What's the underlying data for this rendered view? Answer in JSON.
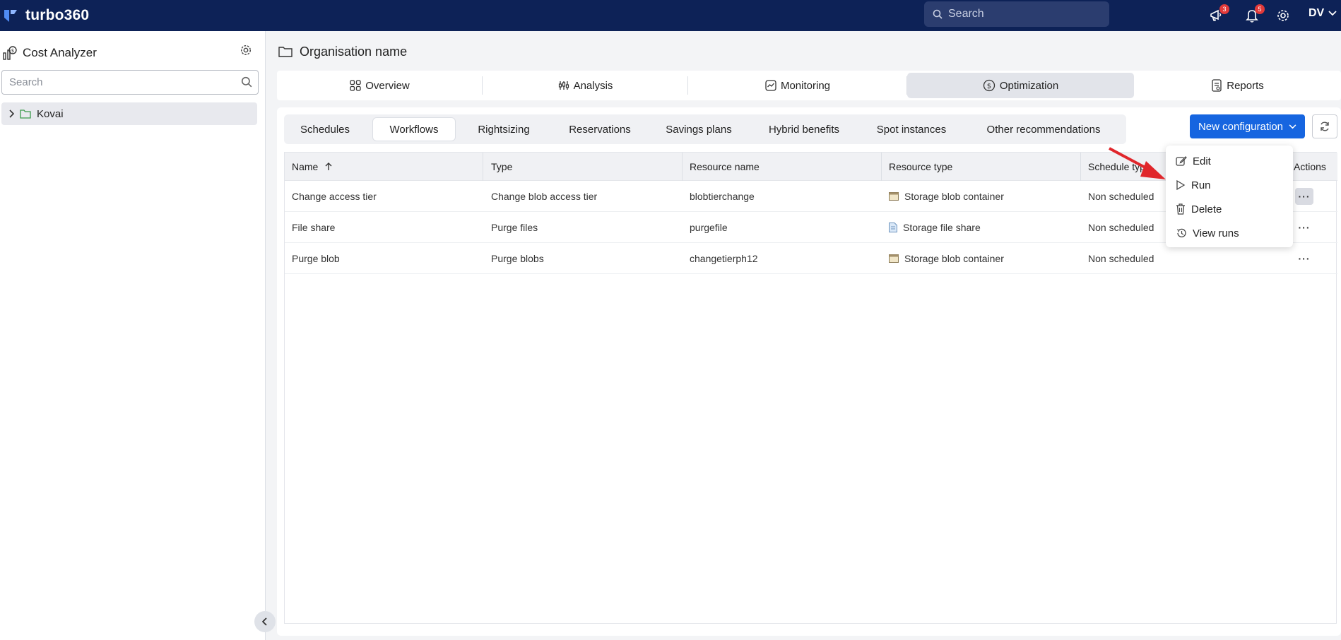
{
  "app": {
    "name": "turbo360",
    "brand_color": "#0d2257",
    "accent": "#1665e0"
  },
  "topbar": {
    "search_placeholder": "Search",
    "announcements_badge": "3",
    "notifications_badge": "5",
    "user_initials": "DV"
  },
  "sidebar": {
    "title": "Cost Analyzer",
    "search_placeholder": "Search",
    "tree": [
      {
        "label": "Kovai"
      }
    ]
  },
  "main": {
    "title": "Organisation name",
    "nav_tabs": [
      {
        "label": "Overview",
        "icon": "grid-icon"
      },
      {
        "label": "Analysis",
        "icon": "analysis-icon"
      },
      {
        "label": "Monitoring",
        "icon": "monitoring-icon"
      },
      {
        "label": "Optimization",
        "icon": "dollar-icon",
        "active": true
      },
      {
        "label": "Reports",
        "icon": "report-icon"
      }
    ],
    "sub_tabs": [
      {
        "label": "Schedules"
      },
      {
        "label": "Workflows",
        "active": true
      },
      {
        "label": "Rightsizing"
      },
      {
        "label": "Reservations"
      },
      {
        "label": "Savings plans"
      },
      {
        "label": "Hybrid benefits"
      },
      {
        "label": "Spot instances"
      },
      {
        "label": "Other recommendations"
      }
    ],
    "new_config_label": "New configuration",
    "table": {
      "columns": [
        "Name",
        "Type",
        "Resource name",
        "Resource type",
        "Schedule type",
        "Actions"
      ],
      "rows": [
        {
          "name": "Change access tier",
          "type": "Change blob access tier",
          "resource_name": "blobtierchange",
          "resource_type": "Storage blob container",
          "schedule_type": "Non scheduled"
        },
        {
          "name": "File share",
          "type": "Purge files",
          "resource_name": "purgefile",
          "resource_type": "Storage file share",
          "schedule_type": "Non scheduled"
        },
        {
          "name": "Purge blob",
          "type": "Purge blobs",
          "resource_name": "changetierph12",
          "resource_type": "Storage blob container",
          "schedule_type": "Non scheduled"
        }
      ]
    },
    "actions_menu": [
      {
        "label": "Edit",
        "icon": "edit-icon"
      },
      {
        "label": "Run",
        "icon": "play-icon"
      },
      {
        "label": "Delete",
        "icon": "trash-icon"
      },
      {
        "label": "View runs",
        "icon": "history-icon"
      }
    ]
  }
}
